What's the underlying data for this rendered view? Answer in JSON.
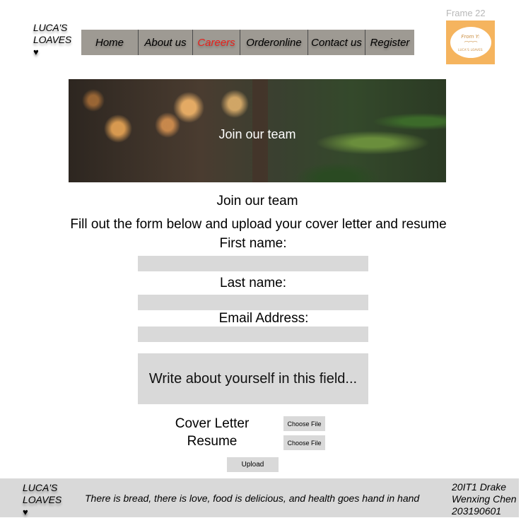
{
  "brand": {
    "line1": "LUCA'S",
    "line2": "LOAVES",
    "heart": "♥"
  },
  "nav": {
    "items": [
      {
        "label": "Home",
        "active": false
      },
      {
        "label": "About us",
        "active": false
      },
      {
        "label": "Careers",
        "active": true
      },
      {
        "label": "Orderonline",
        "active": false
      },
      {
        "label": "Contact us",
        "active": false
      },
      {
        "label": "Register",
        "active": false
      }
    ],
    "active_color": "#e8211c"
  },
  "frame_label": "Frame 22",
  "logo": {
    "top_text": "From Y:",
    "bread": "⌒⌒⌒",
    "name": "LUCA'S LOAVES"
  },
  "hero": {
    "title": "Join our team"
  },
  "main": {
    "heading": "Join our team",
    "instructions": "Fill out the form below and upload your cover letter and resume",
    "first_name_label": "First name:",
    "last_name_label": "Last name:",
    "email_label": "Email Address:",
    "about_placeholder": "Write about yourself in this field...",
    "cover_letter_label": "Cover Letter",
    "resume_label": "Resume",
    "choose_file_label": "Choose File",
    "upload_label": "Upload"
  },
  "footer": {
    "brand_line1": "LUCA'S",
    "brand_line2": "LOAVES",
    "heart": "♥",
    "tagline": "There is bread, there is love, food is delicious, and health goes hand in hand",
    "credit_line1": "20IT1 Drake",
    "credit_line2": "Wenxing Chen",
    "credit_line3": "203190601"
  }
}
